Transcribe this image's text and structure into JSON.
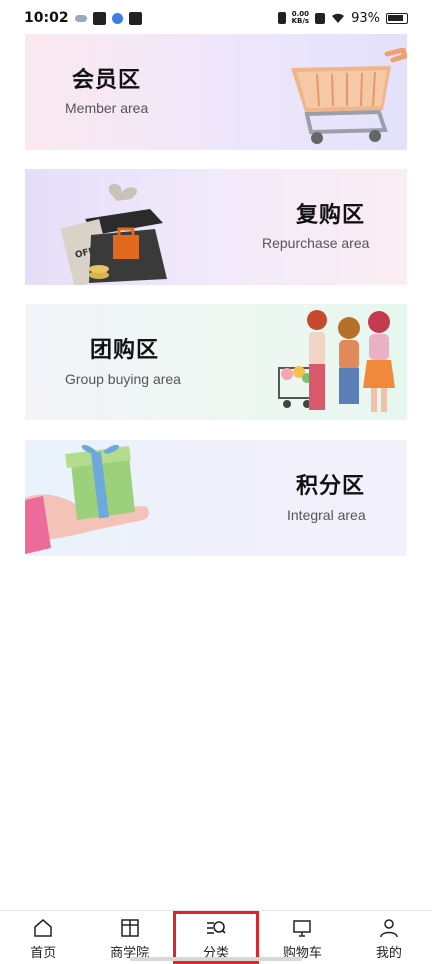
{
  "status_bar": {
    "time": "10:02",
    "net_speed_value": "0.00",
    "net_speed_unit": "KB/s",
    "battery": "93%"
  },
  "cards": [
    {
      "title": "会员区",
      "subtitle": "Member area",
      "illustration": "shopping-cart-icon"
    },
    {
      "title": "复购区",
      "subtitle": "Repurchase area",
      "illustration": "gift-box-icon"
    },
    {
      "title": "团购区",
      "subtitle": "Group buying area",
      "illustration": "group-shoppers-icon"
    },
    {
      "title": "积分区",
      "subtitle": "Integral area",
      "illustration": "gift-in-hand-icon"
    }
  ],
  "bottom_nav": {
    "items": [
      {
        "label": "首页",
        "icon": "home-icon"
      },
      {
        "label": "商学院",
        "icon": "book-icon"
      },
      {
        "label": "分类",
        "icon": "category-search-icon",
        "active": true
      },
      {
        "label": "购物车",
        "icon": "cart-icon"
      },
      {
        "label": "我的",
        "icon": "user-icon"
      }
    ]
  },
  "colors": {
    "active_outline": "#e0252a"
  }
}
